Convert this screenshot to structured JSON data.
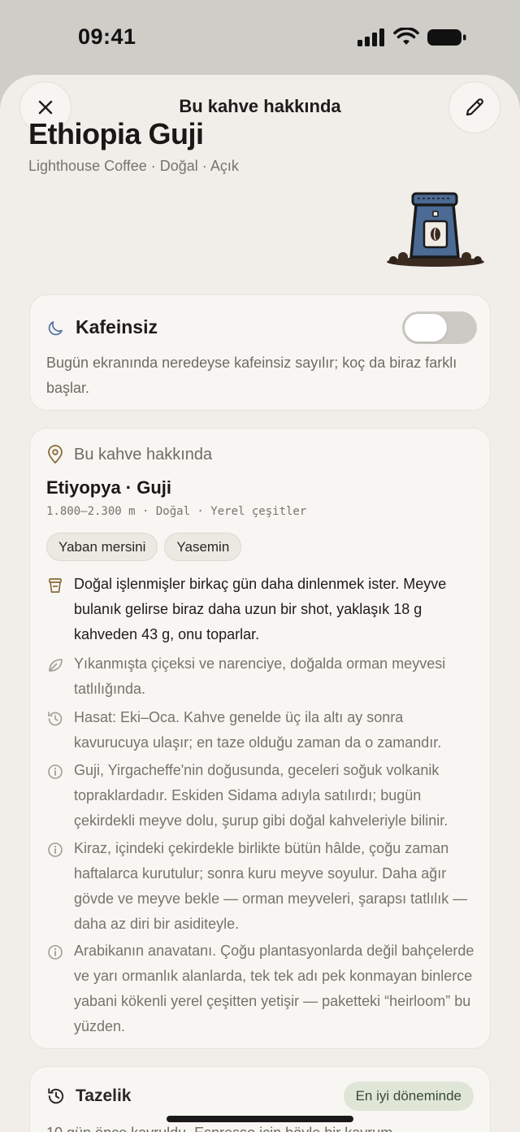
{
  "status_bar": {
    "time": "09:41",
    "icons": [
      "signal-icon",
      "wifi-icon",
      "battery-icon"
    ]
  },
  "header": {
    "title": "Bu kahve hakkında",
    "close_icon": "close-icon",
    "edit_icon": "pencil-icon"
  },
  "coffee": {
    "name": "Ethiopia Guji",
    "meta": "Lighthouse Coffee · Doğal · Açık",
    "illustration": "coffee-bag-illustration"
  },
  "decaf": {
    "icon": "moon-icon",
    "title": "Kafeinsiz",
    "toggle_on": false,
    "description": "Bugün ekranında neredeyse kafeinsiz sayılır; koç da biraz farklı başlar."
  },
  "about": {
    "icon": "location-pin-icon",
    "label": "Bu kahve hakkında",
    "origin_title": "Etiyopya · Guji",
    "origin_sub": "1.800–2.300 m · Doğal · Yerel çeşitler",
    "tags": [
      "Yaban mersini",
      "Yasemin"
    ],
    "notes": [
      {
        "icon": "grinder-icon",
        "text": "Doğal işlenmişler birkaç gün daha dinlenmek ister. Meyve bulanık gelirse biraz daha uzun bir shot, yaklaşık 18 g kahveden 43 g, onu toparlar."
      },
      {
        "icon": "leaf-icon",
        "text": "Yıkanmışta çiçeksi ve narenciye, doğalda orman meyvesi tatlılığında."
      },
      {
        "icon": "history-icon",
        "text": "Hasat: Eki–Oca. Kahve genelde üç ila altı ay sonra kavurucuya ulaşır; en taze olduğu zaman da o zamandır."
      },
      {
        "icon": "info-icon",
        "text": "Guji, Yirgacheffe'nin doğusunda, geceleri soğuk volkanik topraklardadır. Eskiden Sidama adıyla satılırdı; bugün çekirdekli meyve dolu, şurup gibi doğal kahveleriyle bilinir."
      },
      {
        "icon": "info-icon",
        "text": "Kiraz, içindeki çekirdekle birlikte bütün hâlde, çoğu zaman haftalarca kurutulur; sonra kuru meyve soyulur. Daha ağır gövde ve meyve bekle — orman meyveleri, şarapsı tatlılık — daha az diri bir asiditeyle."
      },
      {
        "icon": "info-icon",
        "text": "Arabikanın anavatanı. Çoğu plantasyonlarda değil bahçelerde ve yarı ormanlık alanlarda, tek tek adı pek konmayan binlerce yabani kökenli yerel çeşitten yetişir — paketteki “heirloom” bu yüzden."
      }
    ]
  },
  "freshness": {
    "icon": "history-icon",
    "title": "Tazelik",
    "badge": "En iyi döneminde",
    "description": "10 gün önce kavruldu. Espresso için böyle bir kavrum"
  }
}
